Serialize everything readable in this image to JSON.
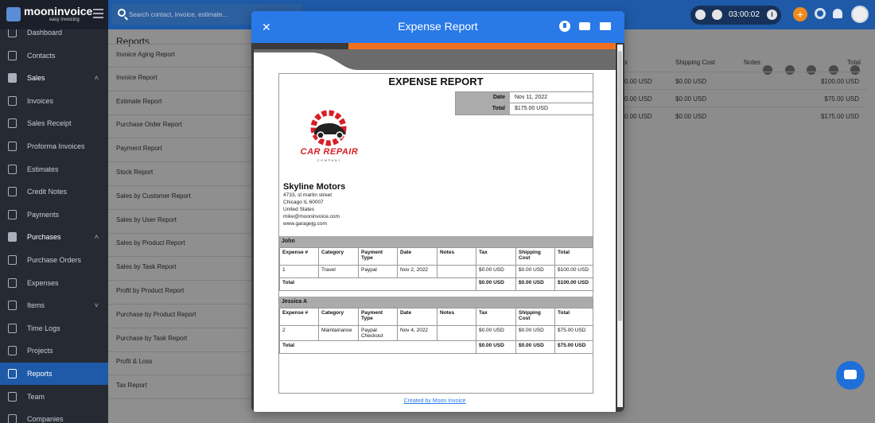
{
  "app": {
    "logo_text": "mooninvoice",
    "logo_sub": "easy invoicing",
    "search_placeholder": "Search contact, invoice, estimate...",
    "timer": "03:00:02"
  },
  "sidebar": {
    "items": [
      {
        "label": "Dashboard",
        "type": "item"
      },
      {
        "label": "Contacts",
        "type": "item"
      },
      {
        "label": "Sales",
        "type": "group"
      },
      {
        "label": "Invoices",
        "type": "item"
      },
      {
        "label": "Sales Receipt",
        "type": "item"
      },
      {
        "label": "Proforma Invoices",
        "type": "item"
      },
      {
        "label": "Estimates",
        "type": "item"
      },
      {
        "label": "Credit Notes",
        "type": "item"
      },
      {
        "label": "Payments",
        "type": "item"
      },
      {
        "label": "Purchases",
        "type": "group"
      },
      {
        "label": "Purchase Orders",
        "type": "item"
      },
      {
        "label": "Expenses",
        "type": "item"
      },
      {
        "label": "Items",
        "type": "item"
      },
      {
        "label": "Time Logs",
        "type": "item"
      },
      {
        "label": "Projects",
        "type": "item"
      },
      {
        "label": "Reports",
        "type": "active"
      },
      {
        "label": "Team",
        "type": "item"
      },
      {
        "label": "Companies",
        "type": "item"
      }
    ]
  },
  "reports": {
    "title": "Reports",
    "items": [
      "Invoice Aging Report",
      "Invoice Report",
      "Estimate Report",
      "Purchase Order Report",
      "Payment Report",
      "Stock Report",
      "Sales by Customer Report",
      "Sales by User Report",
      "Sales by Product Report",
      "Sales by Task Report",
      "Profit by Product Report",
      "Purchase by Product Report",
      "Purchase by Task Report",
      "Profit & Loss",
      "Tax Report"
    ]
  },
  "background_table": {
    "headers": {
      "a": "x",
      "shipping": "Shipping Cost",
      "notes": "Notes",
      "total": "Total"
    },
    "rows": [
      {
        "a": "0.00 USD",
        "shipping": "$0.00 USD",
        "total": "$100.00 USD"
      },
      {
        "a": "0.00 USD",
        "shipping": "$0.00 USD",
        "total": "$75.00 USD"
      },
      {
        "a": "0.00 USD",
        "shipping": "$0.00 USD",
        "total": "$175.00 USD"
      }
    ]
  },
  "modal": {
    "title": "Expense Report",
    "footer_link": "Created by Moon Invoice"
  },
  "report": {
    "title": "EXPENSE REPORT",
    "date_label": "Date",
    "date_value": "Nov 11, 2022",
    "total_label": "Total",
    "total_value": "$175.00 USD",
    "logo_text": "CAR REPAIR",
    "logo_sub": "COMPANY",
    "company_name": "Skyline Motors",
    "address": [
      "4733, st martin street",
      "Chicago IL 60007",
      "United States",
      "mike@mooninvoice.com",
      "www.garagejg.com"
    ],
    "columns": [
      "Expense #",
      "Category",
      "Payment Type",
      "Date",
      "Notes",
      "Tax",
      "Shipping Cost",
      "Total"
    ],
    "groups": [
      {
        "name": "John",
        "rows": [
          [
            "1",
            "Travel",
            "Paypal",
            "Nov 2, 2022",
            "",
            "$0.00 USD",
            "$0.00 USD",
            "$100.00 USD"
          ]
        ],
        "total_label": "Total",
        "total": [
          "$0.00 USD",
          "$0.00 USD",
          "$100.00 USD"
        ]
      },
      {
        "name": "Jessica A",
        "rows": [
          [
            "2",
            "Maintainance",
            "Paypal Checkout",
            "Nov 4, 2022",
            "",
            "$0.00 USD",
            "$0.00 USD",
            "$75.00 USD"
          ]
        ],
        "total_label": "Total",
        "total": [
          "$0.00 USD",
          "$0.00 USD",
          "$75.00 USD"
        ]
      }
    ]
  },
  "colors": {
    "header_blue": "#2979e8",
    "topbar_blue": "#1e5aa8",
    "orange": "#f07020",
    "logo_red": "#d81e26"
  }
}
